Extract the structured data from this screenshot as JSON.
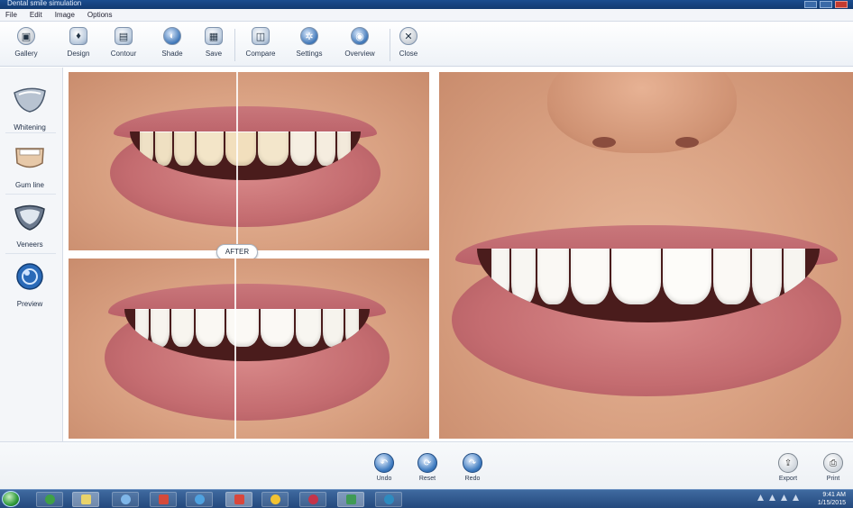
{
  "window": {
    "title": "Dental smile simulation"
  },
  "menu": [
    "File",
    "Edit",
    "Image",
    "Options"
  ],
  "toolbar": [
    {
      "id": "gallery",
      "label": "Gallery",
      "icon": "photo-icon"
    },
    {
      "id": "design",
      "label": "Design",
      "icon": "tooth-icon"
    },
    {
      "id": "contour",
      "label": "Contour",
      "icon": "contour-icon"
    },
    {
      "id": "shade",
      "label": "Shade",
      "icon": "shade-icon"
    },
    {
      "id": "save",
      "label": "Save",
      "icon": "save-icon"
    },
    {
      "id": "compare",
      "label": "Compare",
      "icon": "compare-icon"
    },
    {
      "id": "settings",
      "label": "Settings",
      "icon": "gear-icon"
    },
    {
      "id": "overview",
      "label": "Overview",
      "icon": "overview-icon"
    },
    {
      "id": "close",
      "label": "Close",
      "icon": "close-icon"
    }
  ],
  "left_panel": [
    {
      "label": "Whitening",
      "icon": "veneer-icon"
    },
    {
      "label": "Gum line",
      "icon": "gum-icon"
    },
    {
      "label": "Veneers",
      "icon": "shield-tooth-icon"
    },
    {
      "label": "Preview",
      "icon": "globe-icon"
    }
  ],
  "split_label": "AFTER",
  "bottom_left": [
    {
      "label": "Undo",
      "icon": "undo-icon"
    },
    {
      "label": "Reset",
      "icon": "reset-icon"
    },
    {
      "label": "Redo",
      "icon": "redo-icon"
    }
  ],
  "bottom_right": [
    {
      "label": "Export",
      "icon": "export-icon"
    },
    {
      "label": "Print",
      "icon": "print-icon"
    }
  ],
  "taskbar": {
    "time": "9:41 AM",
    "date": "1/15/2015"
  },
  "colors": {
    "accent": "#1d4c88",
    "titlebar": "#1a4d8f",
    "taskbar": "#2b5189"
  }
}
